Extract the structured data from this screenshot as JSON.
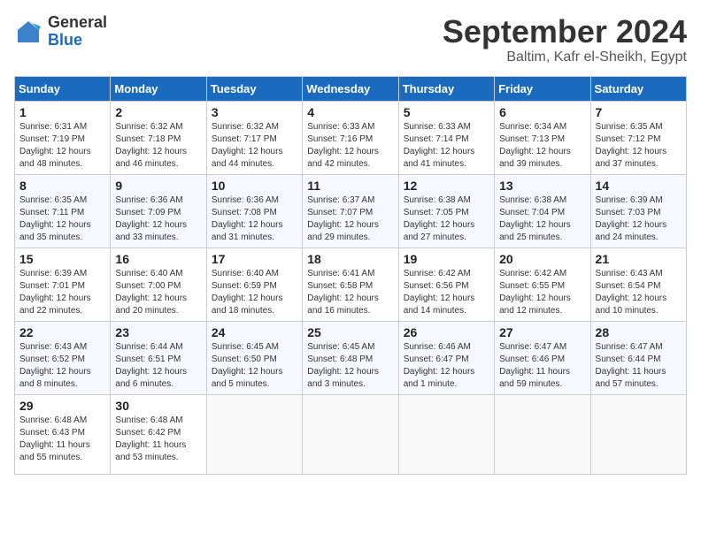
{
  "logo": {
    "general": "General",
    "blue": "Blue"
  },
  "header": {
    "month": "September 2024",
    "location": "Baltim, Kafr el-Sheikh, Egypt"
  },
  "days_of_week": [
    "Sunday",
    "Monday",
    "Tuesday",
    "Wednesday",
    "Thursday",
    "Friday",
    "Saturday"
  ],
  "weeks": [
    [
      {
        "day": "1",
        "info": "Sunrise: 6:31 AM\nSunset: 7:19 PM\nDaylight: 12 hours\nand 48 minutes."
      },
      {
        "day": "2",
        "info": "Sunrise: 6:32 AM\nSunset: 7:18 PM\nDaylight: 12 hours\nand 46 minutes."
      },
      {
        "day": "3",
        "info": "Sunrise: 6:32 AM\nSunset: 7:17 PM\nDaylight: 12 hours\nand 44 minutes."
      },
      {
        "day": "4",
        "info": "Sunrise: 6:33 AM\nSunset: 7:16 PM\nDaylight: 12 hours\nand 42 minutes."
      },
      {
        "day": "5",
        "info": "Sunrise: 6:33 AM\nSunset: 7:14 PM\nDaylight: 12 hours\nand 41 minutes."
      },
      {
        "day": "6",
        "info": "Sunrise: 6:34 AM\nSunset: 7:13 PM\nDaylight: 12 hours\nand 39 minutes."
      },
      {
        "day": "7",
        "info": "Sunrise: 6:35 AM\nSunset: 7:12 PM\nDaylight: 12 hours\nand 37 minutes."
      }
    ],
    [
      {
        "day": "8",
        "info": "Sunrise: 6:35 AM\nSunset: 7:11 PM\nDaylight: 12 hours\nand 35 minutes."
      },
      {
        "day": "9",
        "info": "Sunrise: 6:36 AM\nSunset: 7:09 PM\nDaylight: 12 hours\nand 33 minutes."
      },
      {
        "day": "10",
        "info": "Sunrise: 6:36 AM\nSunset: 7:08 PM\nDaylight: 12 hours\nand 31 minutes."
      },
      {
        "day": "11",
        "info": "Sunrise: 6:37 AM\nSunset: 7:07 PM\nDaylight: 12 hours\nand 29 minutes."
      },
      {
        "day": "12",
        "info": "Sunrise: 6:38 AM\nSunset: 7:05 PM\nDaylight: 12 hours\nand 27 minutes."
      },
      {
        "day": "13",
        "info": "Sunrise: 6:38 AM\nSunset: 7:04 PM\nDaylight: 12 hours\nand 25 minutes."
      },
      {
        "day": "14",
        "info": "Sunrise: 6:39 AM\nSunset: 7:03 PM\nDaylight: 12 hours\nand 24 minutes."
      }
    ],
    [
      {
        "day": "15",
        "info": "Sunrise: 6:39 AM\nSunset: 7:01 PM\nDaylight: 12 hours\nand 22 minutes."
      },
      {
        "day": "16",
        "info": "Sunrise: 6:40 AM\nSunset: 7:00 PM\nDaylight: 12 hours\nand 20 minutes."
      },
      {
        "day": "17",
        "info": "Sunrise: 6:40 AM\nSunset: 6:59 PM\nDaylight: 12 hours\nand 18 minutes."
      },
      {
        "day": "18",
        "info": "Sunrise: 6:41 AM\nSunset: 6:58 PM\nDaylight: 12 hours\nand 16 minutes."
      },
      {
        "day": "19",
        "info": "Sunrise: 6:42 AM\nSunset: 6:56 PM\nDaylight: 12 hours\nand 14 minutes."
      },
      {
        "day": "20",
        "info": "Sunrise: 6:42 AM\nSunset: 6:55 PM\nDaylight: 12 hours\nand 12 minutes."
      },
      {
        "day": "21",
        "info": "Sunrise: 6:43 AM\nSunset: 6:54 PM\nDaylight: 12 hours\nand 10 minutes."
      }
    ],
    [
      {
        "day": "22",
        "info": "Sunrise: 6:43 AM\nSunset: 6:52 PM\nDaylight: 12 hours\nand 8 minutes."
      },
      {
        "day": "23",
        "info": "Sunrise: 6:44 AM\nSunset: 6:51 PM\nDaylight: 12 hours\nand 6 minutes."
      },
      {
        "day": "24",
        "info": "Sunrise: 6:45 AM\nSunset: 6:50 PM\nDaylight: 12 hours\nand 5 minutes."
      },
      {
        "day": "25",
        "info": "Sunrise: 6:45 AM\nSunset: 6:48 PM\nDaylight: 12 hours\nand 3 minutes."
      },
      {
        "day": "26",
        "info": "Sunrise: 6:46 AM\nSunset: 6:47 PM\nDaylight: 12 hours\nand 1 minute."
      },
      {
        "day": "27",
        "info": "Sunrise: 6:47 AM\nSunset: 6:46 PM\nDaylight: 11 hours\nand 59 minutes."
      },
      {
        "day": "28",
        "info": "Sunrise: 6:47 AM\nSunset: 6:44 PM\nDaylight: 11 hours\nand 57 minutes."
      }
    ],
    [
      {
        "day": "29",
        "info": "Sunrise: 6:48 AM\nSunset: 6:43 PM\nDaylight: 11 hours\nand 55 minutes."
      },
      {
        "day": "30",
        "info": "Sunrise: 6:48 AM\nSunset: 6:42 PM\nDaylight: 11 hours\nand 53 minutes."
      },
      {
        "day": "",
        "info": ""
      },
      {
        "day": "",
        "info": ""
      },
      {
        "day": "",
        "info": ""
      },
      {
        "day": "",
        "info": ""
      },
      {
        "day": "",
        "info": ""
      }
    ]
  ]
}
